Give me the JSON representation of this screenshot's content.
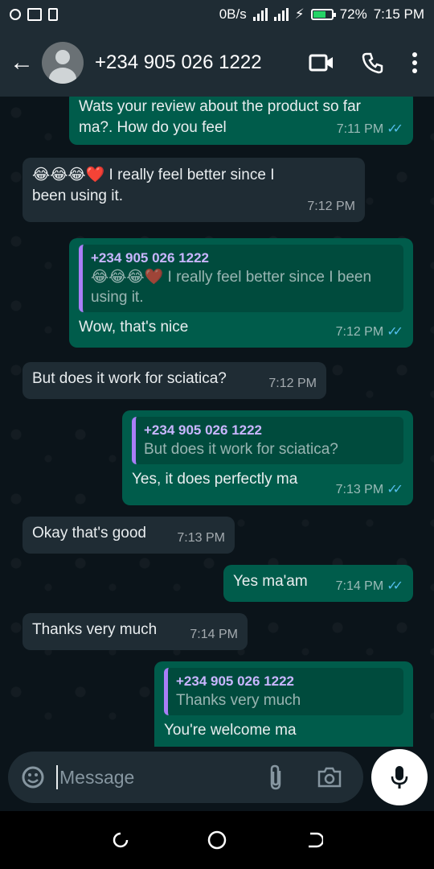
{
  "status_bar": {
    "net_speed": "0B/s",
    "battery": "72%",
    "battery_level": 0.72,
    "time": "7:15 PM"
  },
  "header": {
    "contact": "+234 905 026 1222",
    "icons": [
      "back-arrow-icon",
      "avatar",
      "video-call-icon",
      "voice-call-icon",
      "more-vert-icon"
    ]
  },
  "messages": [
    {
      "type": "out",
      "text_line1": "Wats your review about the product so far",
      "text_line2": "ma?. How do you feel",
      "time": "7:11 PM"
    },
    {
      "type": "in",
      "emoji": "😂😂😂❤️",
      "text_line1": " I really feel better since I",
      "text_line2": "been using it.",
      "time": "7:12 PM"
    },
    {
      "type": "out",
      "quote_author": "+234 905 026 1222",
      "quote_emoji": "😂😂😂❤️",
      "quote_line1": " I really feel better since I been",
      "quote_line2": "using it.",
      "text": "Wow, that's nice",
      "time": "7:12 PM"
    },
    {
      "type": "in",
      "text": "But does it work for sciatica?",
      "time": "7:12 PM"
    },
    {
      "type": "out",
      "quote_author": "+234 905 026 1222",
      "quote_text": "But does it work for sciatica?",
      "text": "Yes, it does perfectly ma",
      "time": "7:13 PM"
    },
    {
      "type": "in",
      "text": "Okay that's good",
      "time": "7:13 PM"
    },
    {
      "type": "out",
      "text": "Yes ma'am",
      "time": "7:14 PM"
    },
    {
      "type": "in",
      "text": "Thanks very much",
      "time": "7:14 PM"
    },
    {
      "type": "out",
      "quote_author": "+234 905 026 1222",
      "quote_text": "Thanks very much",
      "text": "You're welcome ma"
    }
  ],
  "input": {
    "placeholder": "Message"
  },
  "colors": {
    "background": "#0b141a",
    "bar": "#1f2c34",
    "outgoing": "#005c4b",
    "incoming": "#1f2c34",
    "read_ticks": "#53bdeb",
    "quote_bar": "#a97ef8"
  }
}
